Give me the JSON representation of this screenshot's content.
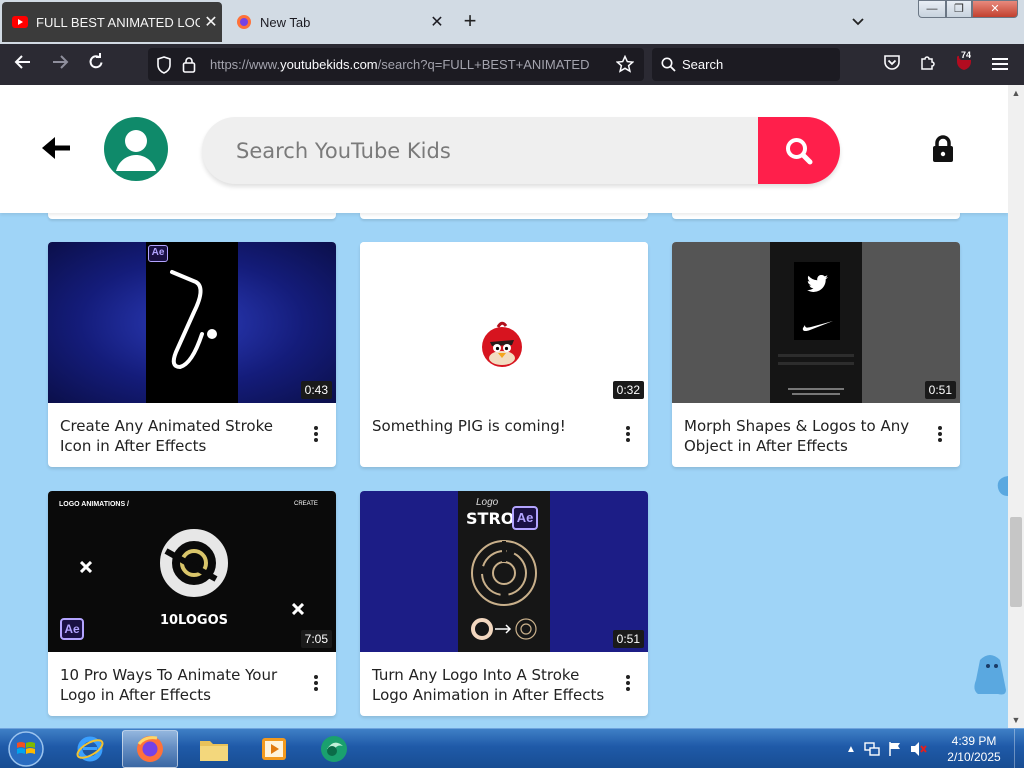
{
  "browser": {
    "tabs": [
      {
        "label": "FULL BEST ANIMATED LOGOS",
        "active": true,
        "favicon": "youtube-icon"
      },
      {
        "label": "New Tab",
        "active": false,
        "favicon": "firefox-icon"
      }
    ],
    "url_prefix": "https://www.",
    "url_domain": "youtubekids.com",
    "url_rest": "/search?q=FULL+BEST+ANIMATED",
    "search_placeholder": "Search",
    "extension_badge": "74"
  },
  "header": {
    "search_placeholder": "Search YouTube Kids",
    "accent_color": "#ff1f4b",
    "avatar_color": "#0f8a6a"
  },
  "videos": [
    {
      "title": "Create Any Animated Stroke Icon in After Effects",
      "duration": "0:43",
      "thumb_label": "Ae"
    },
    {
      "title": "Something PIG is coming!",
      "duration": "0:32"
    },
    {
      "title": "Morph Shapes & Logos to Any Object in After Effects",
      "duration": "0:51"
    },
    {
      "title": "10 Pro Ways To Animate Your Logo in After Effects",
      "duration": "7:05",
      "thumb_label": "Ae",
      "thumb_title": "LOGO ANIMATIONS /",
      "thumb_side": "CREATE",
      "thumb_caption": "10LOGOS"
    },
    {
      "title": "Turn Any Logo Into A Stroke Logo Animation in After Effects",
      "duration": "0:51",
      "thumb_label": "Ae",
      "thumb_caption": "STROKE",
      "thumb_script": "Logo"
    }
  ],
  "taskbar": {
    "apps": [
      "internet-explorer-icon",
      "firefox-icon",
      "file-explorer-icon",
      "media-player-icon",
      "app-icon"
    ],
    "time": "4:39 PM",
    "date": "2/10/2025"
  }
}
